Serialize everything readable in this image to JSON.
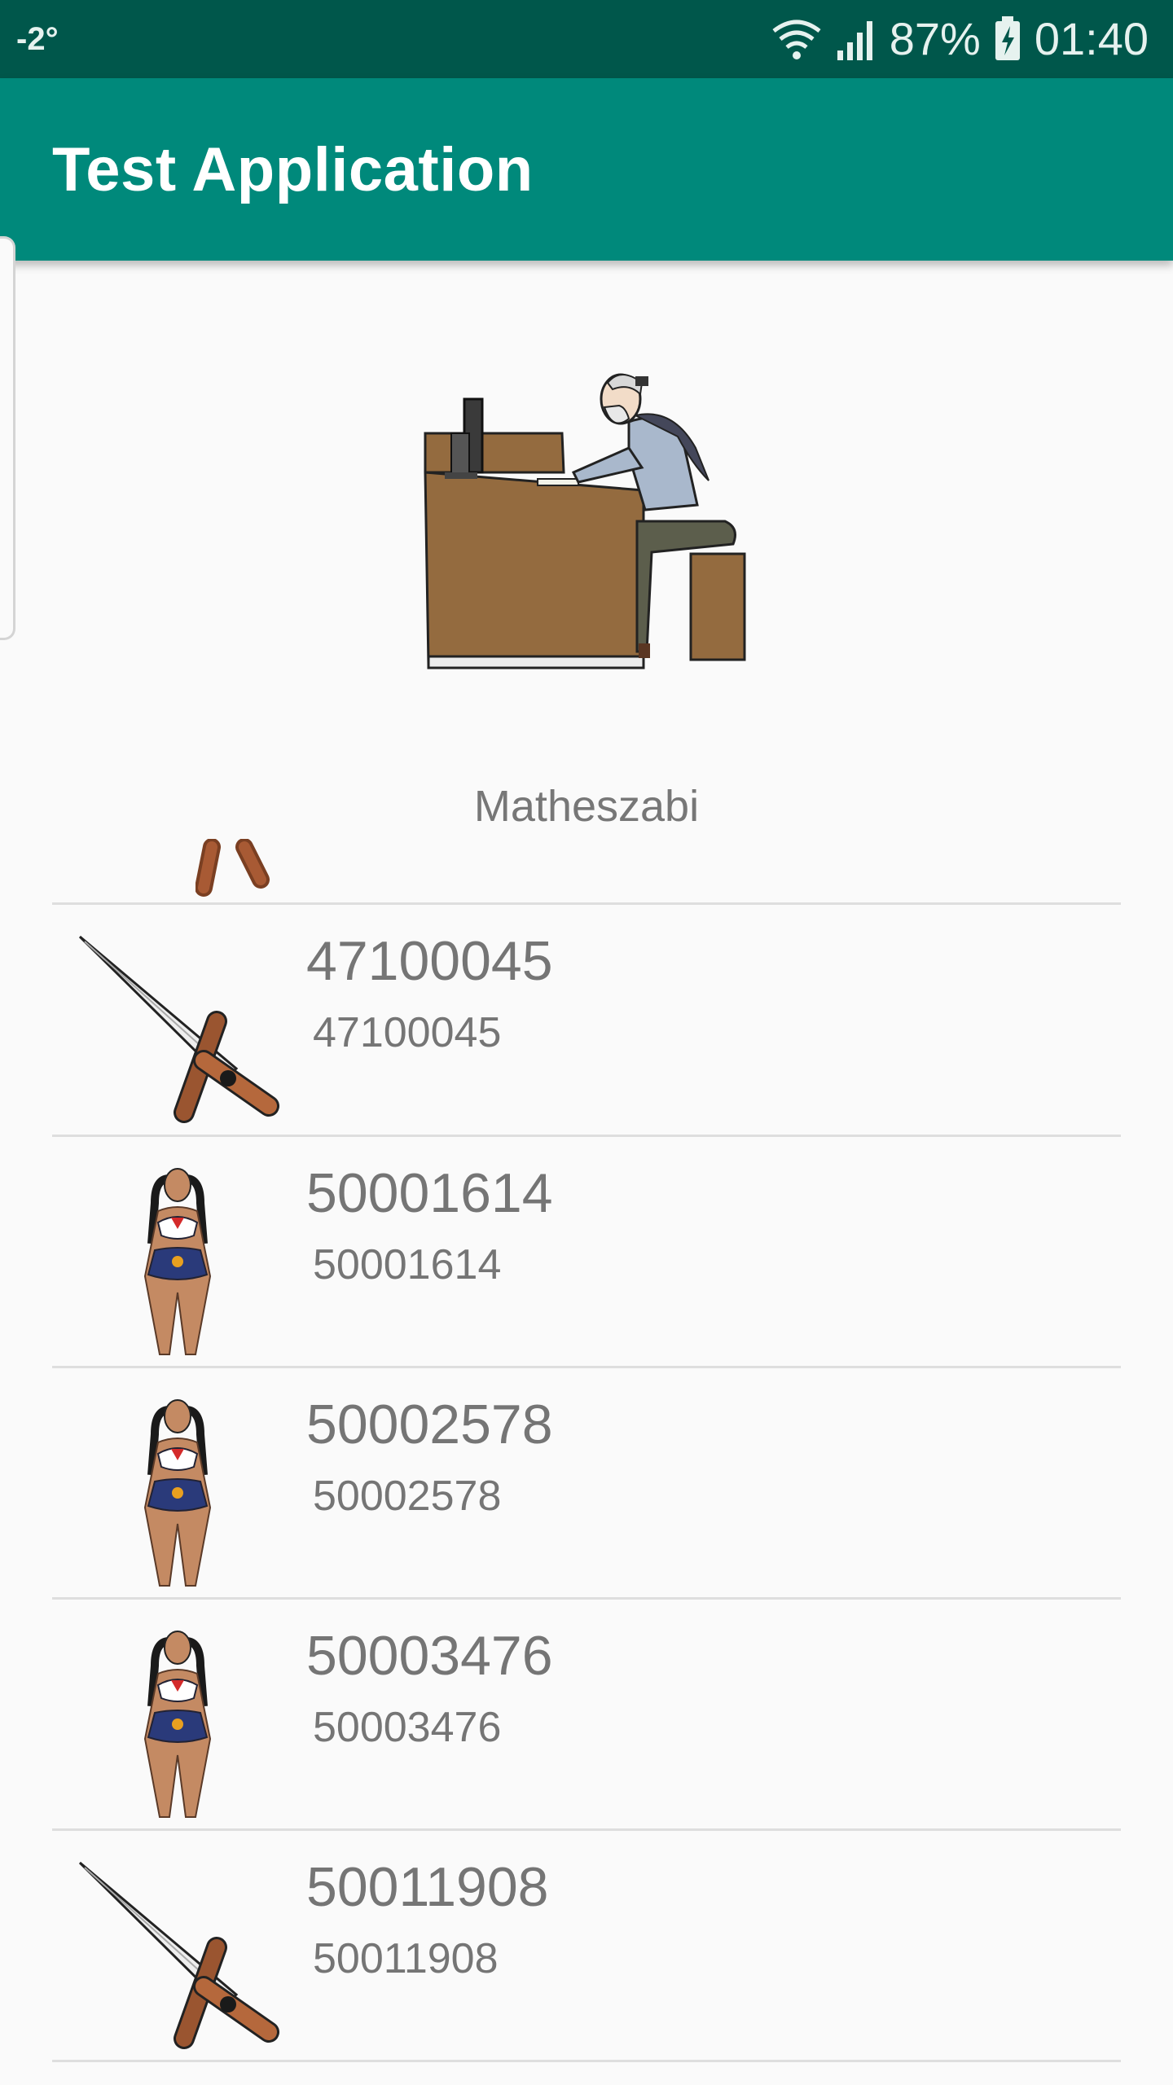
{
  "status_bar": {
    "temperature": "-2°",
    "battery": "87%",
    "time": "01:40",
    "icons": [
      "wifi-icon",
      "signal-icon",
      "battery-charging-icon"
    ]
  },
  "app_bar": {
    "title": "Test Application",
    "color": "#00897b",
    "status_color": "#00574b"
  },
  "header": {
    "image": "person-at-computer-illustration",
    "name": "Matheszabi"
  },
  "list": {
    "items": [
      {
        "title": "47100045",
        "subtitle": "47100045",
        "thumbnail": "sword-icon"
      },
      {
        "title": "50001614",
        "subtitle": "50001614",
        "thumbnail": "woman-figure-icon"
      },
      {
        "title": "50002578",
        "subtitle": "50002578",
        "thumbnail": "woman-figure-icon"
      },
      {
        "title": "50003476",
        "subtitle": "50003476",
        "thumbnail": "woman-figure-icon"
      },
      {
        "title": "50011908",
        "subtitle": "50011908",
        "thumbnail": "sword-icon"
      }
    ]
  }
}
